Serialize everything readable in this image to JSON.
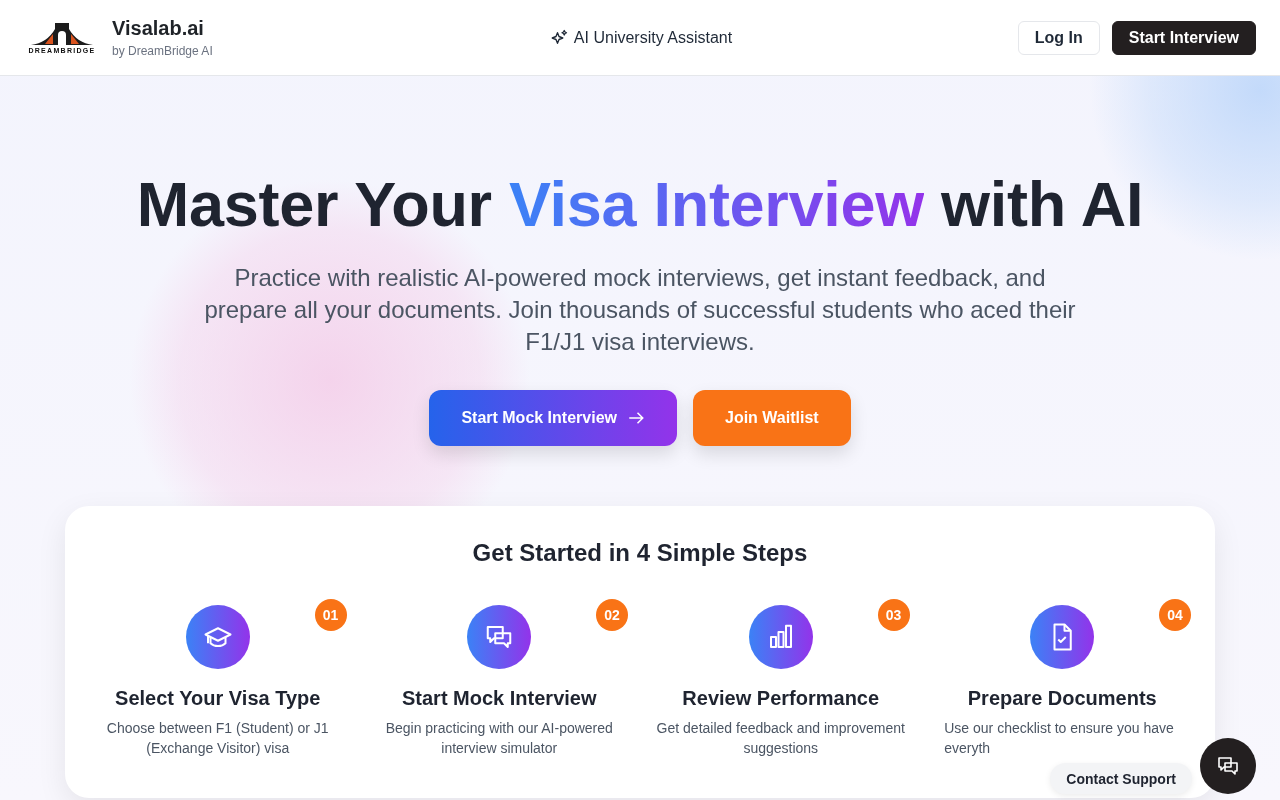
{
  "header": {
    "logo_word": "DREAMBRIDGE",
    "brand": "Visalab.ai",
    "tagline": "by DreamBridge AI",
    "center_link": "AI University Assistant",
    "buttons": [
      {
        "label": "Log In",
        "kind": "outline"
      },
      {
        "label": "Start Interview",
        "kind": "dark"
      }
    ]
  },
  "hero": {
    "title_before": "Master Your ",
    "title_highlight": "Visa Interview",
    "title_after": " with AI",
    "subtitle": "Practice with realistic AI-powered mock interviews, get instant feedback, and prepare all your documents. Join thousands of successful students who aced their F1/J1 visa interviews.",
    "buttons": [
      {
        "label": "Start Mock Interview",
        "kind": "gradient"
      },
      {
        "label": "Join Waitlist",
        "kind": "orange"
      }
    ]
  },
  "steps_card": {
    "title": "Get Started in 4 Simple Steps",
    "steps": [
      {
        "number": "01",
        "kind": "cap",
        "title": "Select Your Visa Type",
        "description": "Choose between F1 (Student) or J1 (Exchange Visitor) visa"
      },
      {
        "number": "02",
        "kind": "chat",
        "title": "Start Mock Interview",
        "description": "Begin practicing with our AI-powered interview simulator"
      },
      {
        "number": "03",
        "kind": "bars",
        "title": "Review Performance",
        "description": "Get detailed feedback and improvement suggestions"
      },
      {
        "number": "04",
        "kind": "doc",
        "title": "Prepare Documents",
        "description": "Use our checklist to ensure you have everyth"
      }
    ]
  },
  "support": {
    "label": "Contact Support"
  }
}
